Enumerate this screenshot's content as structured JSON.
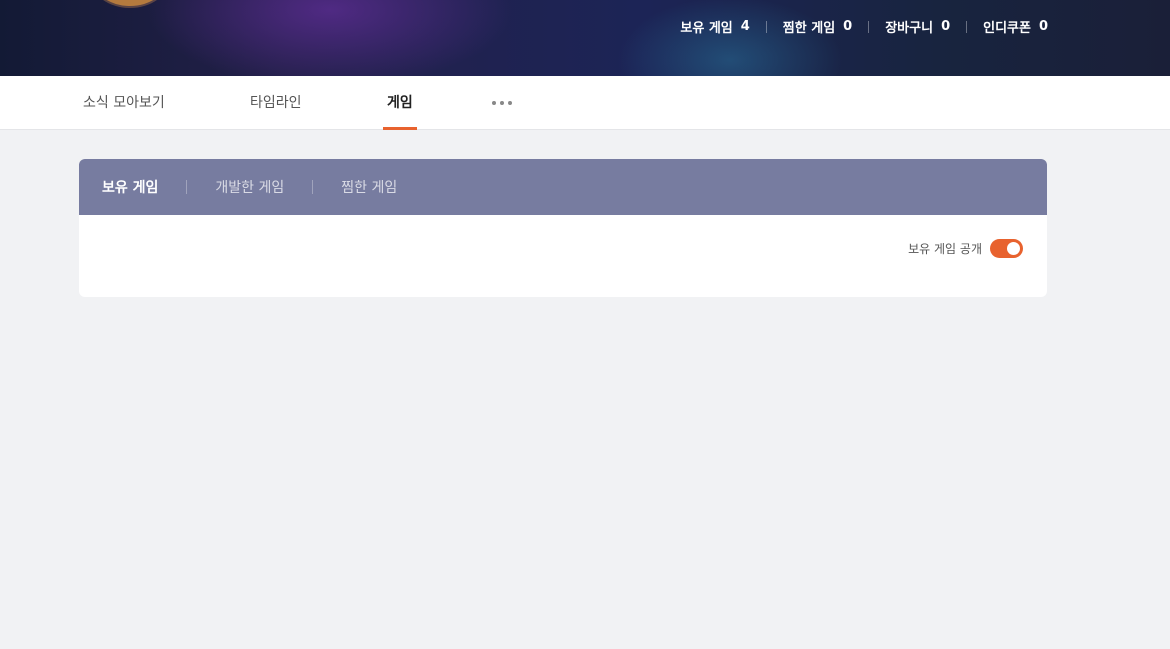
{
  "header": {
    "stats": [
      {
        "label": "보유 게임",
        "count": "4"
      },
      {
        "label": "찜한 게임",
        "count": "0"
      },
      {
        "label": "장바구니",
        "count": "0"
      },
      {
        "label": "인디쿠폰",
        "count": "0"
      }
    ]
  },
  "nav": {
    "tabs": [
      {
        "label": "소식 모아보기"
      },
      {
        "label": "타임라인"
      },
      {
        "label": "게임"
      }
    ],
    "active": "게임"
  },
  "games_panel": {
    "tabs": [
      {
        "label": "보유 게임"
      },
      {
        "label": "개발한 게임"
      },
      {
        "label": "찜한 게임"
      }
    ],
    "active": "보유 게임",
    "toggle_label": "보유 게임 공개",
    "toggle_on": true
  },
  "colors": {
    "accent": "#e8622e",
    "panel_header": "#777ca0",
    "background": "#f1f2f4"
  }
}
